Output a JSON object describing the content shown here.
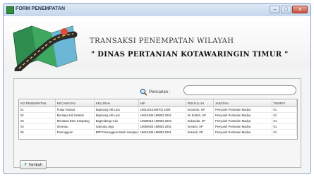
{
  "window": {
    "title": "FORM PENEMPATAN",
    "minimize_label": "–",
    "maximize_label": "□",
    "close_label": "x"
  },
  "header": {
    "title": "TRANSAKSI PENEMPATAN WILAYAH",
    "subtitle": "\" DINAS PERTANIAN KOTAWARINGIN TIMUR \""
  },
  "search": {
    "label": "Pencarian :",
    "value": "",
    "placeholder": ""
  },
  "table": {
    "columns": [
      "NO PENEMPATAN",
      "KECAMATAN",
      "KELURAH",
      "NIP",
      "PENYULUH",
      "JABATAN",
      "TEMPAT"
    ],
    "rows": [
      [
        "01",
        "Pulau Hanaut",
        "Bapinang Hili Laut",
        "19611015198703 1009",
        "Sumanto, SP",
        "Penyuluh Pertanian Madya",
        "01"
      ],
      [
        "02",
        "Mentaya Hili Selatan",
        "Bapinang Hili Laut",
        "19610406 198803 2001",
        "Sri Endah, SP",
        "Penyuluh Pertanian Madya",
        "01"
      ],
      [
        "03",
        "Mentawa Baru Ketapang",
        "Bagendang Hulu",
        "19680513 198803 2003",
        "Sukandar, SP",
        "Penyuluh Pertanian Madya",
        "01"
      ],
      [
        "04",
        "Seranau",
        "Samuda Jaya",
        "19650628 198803 2001",
        "Sunarsi, SP",
        "Penyuluh Pertanian Madya",
        "01"
      ],
      [
        "05",
        "Parenggean",
        "BPP Parenggean Bukit Harapan",
        "19610406 198803 1001",
        "Sukardi, SP",
        "Penyuluh Pertanian Madya",
        "01"
      ]
    ]
  },
  "actions": {
    "add_label": "Tambah"
  },
  "colors": {
    "titlebar": "#c6d6ec",
    "panel_border": "#b9b9b9"
  },
  "icons": [
    "map-road-icon",
    "search-icon",
    "plus-icon"
  ]
}
